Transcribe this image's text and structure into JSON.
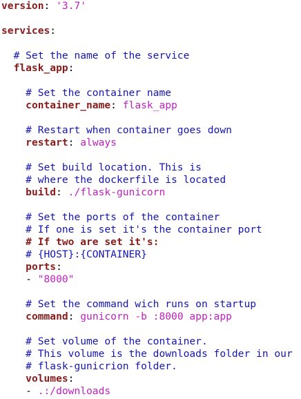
{
  "editor": {
    "lines": [
      {
        "indent": "",
        "parts": [
          {
            "t": "version",
            "c": "key"
          },
          {
            "t": ": ",
            "c": "plain"
          },
          {
            "t": "'3.7'",
            "c": "str"
          }
        ]
      },
      {
        "indent": "",
        "parts": []
      },
      {
        "indent": "",
        "parts": [
          {
            "t": "services",
            "c": "key"
          },
          {
            "t": ":",
            "c": "plain"
          }
        ]
      },
      {
        "indent": "",
        "parts": []
      },
      {
        "indent": "  ",
        "parts": [
          {
            "t": "# Set the name of the service",
            "c": "comment"
          }
        ]
      },
      {
        "indent": "  ",
        "parts": [
          {
            "t": "flask_app",
            "c": "key"
          },
          {
            "t": ":",
            "c": "plain"
          }
        ]
      },
      {
        "indent": "",
        "parts": []
      },
      {
        "indent": "    ",
        "parts": [
          {
            "t": "# Set the container name",
            "c": "comment"
          }
        ]
      },
      {
        "indent": "    ",
        "parts": [
          {
            "t": "container_name",
            "c": "key"
          },
          {
            "t": ": ",
            "c": "plain"
          },
          {
            "t": "flask_app",
            "c": "val"
          }
        ]
      },
      {
        "indent": "",
        "parts": []
      },
      {
        "indent": "    ",
        "parts": [
          {
            "t": "# Restart when container goes down",
            "c": "comment"
          }
        ]
      },
      {
        "indent": "    ",
        "parts": [
          {
            "t": "restart",
            "c": "key"
          },
          {
            "t": ": ",
            "c": "plain"
          },
          {
            "t": "always",
            "c": "val"
          }
        ]
      },
      {
        "indent": "",
        "parts": []
      },
      {
        "indent": "    ",
        "parts": [
          {
            "t": "# Set build location. This is",
            "c": "comment"
          }
        ]
      },
      {
        "indent": "    ",
        "parts": [
          {
            "t": "# where the dockerfile is located",
            "c": "comment"
          }
        ]
      },
      {
        "indent": "    ",
        "parts": [
          {
            "t": "build",
            "c": "key"
          },
          {
            "t": ": ",
            "c": "plain"
          },
          {
            "t": "./flask-gunicorn",
            "c": "val"
          }
        ]
      },
      {
        "indent": "",
        "parts": []
      },
      {
        "indent": "    ",
        "parts": [
          {
            "t": "# Set the ports of the container",
            "c": "comment"
          }
        ]
      },
      {
        "indent": "    ",
        "parts": [
          {
            "t": "# If one is set it's the container port",
            "c": "comment"
          }
        ]
      },
      {
        "indent": "    ",
        "parts": [
          {
            "t": "# If two are set it's:",
            "c": "bold-comment"
          }
        ]
      },
      {
        "indent": "    ",
        "parts": [
          {
            "t": "# {HOST}:{CONTAINER}",
            "c": "comment"
          }
        ]
      },
      {
        "indent": "    ",
        "parts": [
          {
            "t": "ports",
            "c": "key"
          },
          {
            "t": ":",
            "c": "plain"
          }
        ]
      },
      {
        "indent": "    ",
        "parts": [
          {
            "t": "- ",
            "c": "plain"
          },
          {
            "t": "\"8000\"",
            "c": "str"
          }
        ]
      },
      {
        "indent": "",
        "parts": []
      },
      {
        "indent": "    ",
        "parts": [
          {
            "t": "# Set the command wich runs on startup",
            "c": "comment"
          }
        ]
      },
      {
        "indent": "    ",
        "parts": [
          {
            "t": "command",
            "c": "key"
          },
          {
            "t": ": ",
            "c": "plain"
          },
          {
            "t": "gunicorn -b :8000 app:app",
            "c": "val"
          }
        ]
      },
      {
        "indent": "",
        "parts": []
      },
      {
        "indent": "    ",
        "parts": [
          {
            "t": "# Set volume of the container.",
            "c": "comment"
          }
        ]
      },
      {
        "indent": "    ",
        "parts": [
          {
            "t": "# This volume is the downloads folder in our",
            "c": "comment"
          }
        ]
      },
      {
        "indent": "    ",
        "parts": [
          {
            "t": "# flask-gunicrion folder.",
            "c": "comment"
          }
        ]
      },
      {
        "indent": "    ",
        "parts": [
          {
            "t": "volumes",
            "c": "key"
          },
          {
            "t": ":",
            "c": "plain"
          }
        ]
      },
      {
        "indent": "    ",
        "parts": [
          {
            "t": "- ",
            "c": "plain"
          },
          {
            "t": ".:/downloads",
            "c": "val"
          }
        ]
      }
    ]
  }
}
